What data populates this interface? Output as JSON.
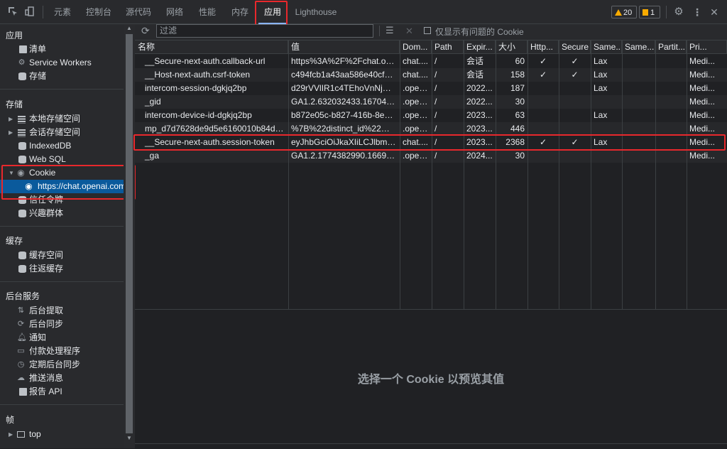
{
  "tabs": [
    "元素",
    "控制台",
    "源代码",
    "网络",
    "性能",
    "内存",
    "应用",
    "Lighthouse"
  ],
  "badges": {
    "warnings": "20",
    "issues": "1"
  },
  "sidebar": {
    "app_head": "应用",
    "app_items": [
      "清单",
      "Service Workers",
      "存储"
    ],
    "storage_head": "存储",
    "storage_items": [
      "本地存储空间",
      "会话存储空间",
      "IndexedDB",
      "Web SQL",
      "Cookie"
    ],
    "cookie_origin": "https://chat.openai.com",
    "storage_items2": [
      "信任令牌",
      "兴趣群体"
    ],
    "cache_head": "缓存",
    "cache_items": [
      "缓存空间",
      "往返缓存"
    ],
    "bg_head": "后台服务",
    "bg_items": [
      "后台提取",
      "后台同步",
      "通知",
      "付款处理程序",
      "定期后台同步",
      "推送消息",
      "报告 API"
    ],
    "frames_head": "帧",
    "frames_items": [
      "top"
    ]
  },
  "toolbar": {
    "filter_placeholder": "过滤",
    "only_issues_label": "仅显示有问题的 Cookie"
  },
  "columns": [
    "名称",
    "值",
    "Dom...",
    "Path",
    "Expir...",
    "大小",
    "Http...",
    "Secure",
    "Same...",
    "Same...",
    "Partit...",
    "Pri..."
  ],
  "rows": [
    [
      "__Secure-next-auth.callback-url",
      "https%3A%2F%2Fchat.ope...",
      "chat....",
      "/",
      "会话",
      "60",
      "✓",
      "✓",
      "Lax",
      "",
      "",
      "Medi..."
    ],
    [
      "__Host-next-auth.csrf-token",
      "c494fcb1a43aa586e40cf150...",
      "chat....",
      "/",
      "会话",
      "158",
      "✓",
      "✓",
      "Lax",
      "",
      "",
      "Medi..."
    ],
    [
      "intercom-session-dgkjq2bp",
      "d29rVVlIR1c4TEhoVnNjUW...",
      ".open...",
      "/",
      "2022...",
      "187",
      "",
      "",
      "Lax",
      "",
      "",
      "Medi..."
    ],
    [
      "_gid",
      "GA1.2.632032433.16704962...",
      ".open...",
      "/",
      "2022...",
      "30",
      "",
      "",
      "",
      "",
      "",
      "Medi..."
    ],
    [
      "intercom-device-id-dgkjq2bp",
      "b872e05c-b827-416b-8e60...",
      ".open...",
      "/",
      "2023...",
      "63",
      "",
      "",
      "Lax",
      "",
      "",
      "Medi..."
    ],
    [
      "mp_d7d7628de9d5e6160010b84db9...",
      "%7B%22distinct_id%22%3A...",
      ".open...",
      "/",
      "2023...",
      "446",
      "",
      "",
      "",
      "",
      "",
      "Medi..."
    ],
    [
      "__Secure-next-auth.session-token",
      "eyJhbGciOiJkaXIiLCJlbmMi...",
      "chat....",
      "/",
      "2023...",
      "2368",
      "✓",
      "✓",
      "Lax",
      "",
      "",
      "Medi..."
    ],
    [
      "_ga",
      "GA1.2.1774382990.1669964...",
      ".open...",
      "/",
      "2024...",
      "30",
      "",
      "",
      "",
      "",
      "",
      "Medi..."
    ]
  ],
  "preview_message": "选择一个 Cookie 以预览其值"
}
